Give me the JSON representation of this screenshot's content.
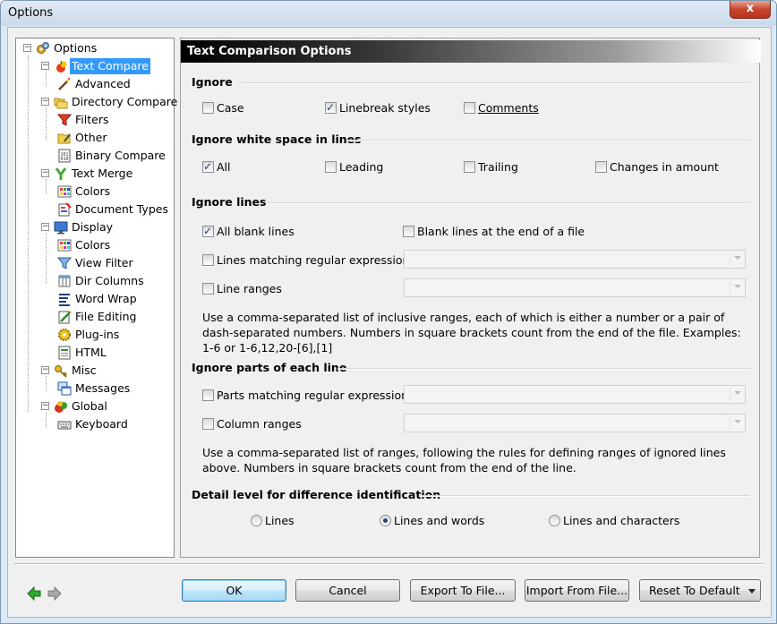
{
  "window": {
    "title": "Options",
    "close_label": "x"
  },
  "tree": {
    "items": [
      {
        "label": "Options"
      },
      {
        "label": "Text Compare"
      },
      {
        "label": "Advanced"
      },
      {
        "label": "Directory Compare"
      },
      {
        "label": "Filters"
      },
      {
        "label": "Other"
      },
      {
        "label": "Binary Compare"
      },
      {
        "label": "Text Merge"
      },
      {
        "label": "Colors"
      },
      {
        "label": "Document Types"
      },
      {
        "label": "Display"
      },
      {
        "label": "Colors"
      },
      {
        "label": "View Filter"
      },
      {
        "label": "Dir Columns"
      },
      {
        "label": "Word Wrap"
      },
      {
        "label": "File Editing"
      },
      {
        "label": "Plug-ins"
      },
      {
        "label": "HTML"
      },
      {
        "label": "Misc"
      },
      {
        "label": "Messages"
      },
      {
        "label": "Global"
      },
      {
        "label": "Keyboard"
      }
    ],
    "selected": "Text Compare"
  },
  "panel": {
    "header": "Text Comparison Options",
    "ignore": {
      "title": "Ignore",
      "case": {
        "label": "Case",
        "checked": false
      },
      "linebreak": {
        "label": "Linebreak styles",
        "checked": true
      },
      "comments": {
        "label": "Comments",
        "checked": false
      }
    },
    "whitespace": {
      "title": "Ignore white space in lines",
      "all": {
        "label": "All",
        "checked": true
      },
      "leading": {
        "label": "Leading",
        "checked": false
      },
      "trailing": {
        "label": "Trailing",
        "checked": false
      },
      "changes": {
        "label": "Changes in amount",
        "checked": false
      }
    },
    "lines": {
      "title": "Ignore lines",
      "blank": {
        "label": "All blank lines",
        "checked": true
      },
      "blank_end": {
        "label": "Blank lines at the end of a file",
        "checked": false
      },
      "regex": {
        "label": "Lines matching regular expression",
        "checked": false,
        "value": ""
      },
      "ranges": {
        "label": "Line ranges",
        "checked": false,
        "value": ""
      },
      "note": "Use a comma-separated list of inclusive ranges, each of which is either a number or a pair of dash-separated numbers. Numbers in square brackets count from the end of the file. Examples: 1-6 or 1-6,12,20-[6],[1]"
    },
    "parts": {
      "title": "Ignore parts of each line",
      "regex": {
        "label": "Parts matching regular expression",
        "checked": false,
        "value": ""
      },
      "columns": {
        "label": "Column ranges",
        "checked": false,
        "value": ""
      },
      "note": "Use a comma-separated list of ranges, following the rules for defining ranges of ignored lines above. Numbers in square brackets count from the end of the line."
    },
    "detail": {
      "title": "Detail level for difference identification",
      "options": [
        "Lines",
        "Lines and words",
        "Lines and characters"
      ],
      "selected": "Lines and words"
    }
  },
  "buttons": {
    "ok": "OK",
    "cancel": "Cancel",
    "export": "Export To File...",
    "import": "Import From File...",
    "reset": "Reset To Default"
  },
  "colors": {
    "selection": "#3399ff",
    "header_start": "#000000",
    "default_button": "#3c7fb1",
    "nav_back": "#2fa62f",
    "nav_forward": "#9a9a9a"
  }
}
